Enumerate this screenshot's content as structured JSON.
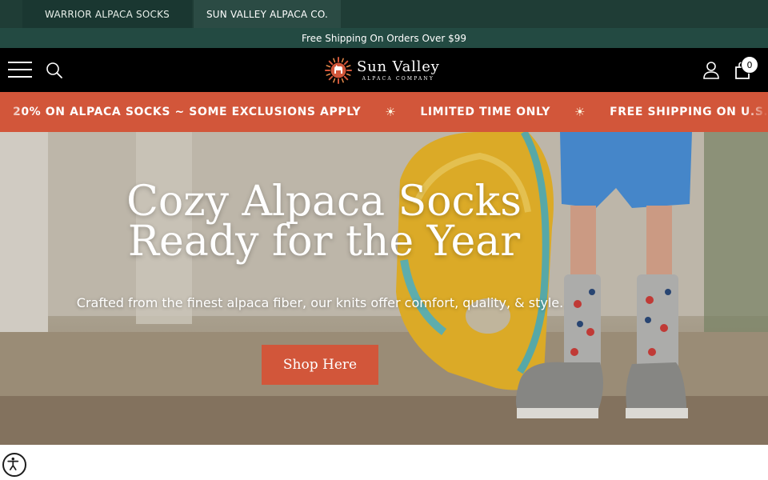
{
  "brand_tabs": [
    {
      "label": "WARRIOR ALPACA SOCKS"
    },
    {
      "label": "SUN VALLEY ALPACA CO."
    }
  ],
  "announcement": "Free Shipping On Orders Over $99",
  "header": {
    "logo_name": "Sun Valley",
    "logo_sub": "ALPACA COMPANY",
    "cart_count": "0",
    "icons": [
      "menu-icon",
      "search-icon",
      "account-icon",
      "cart-icon"
    ]
  },
  "ticker": {
    "items": [
      "20% ON ALPACA SOCKS ~ SOME EXCLUSIONS APPLY",
      "LIMITED TIME ONLY",
      "FREE SHIPPING ON U.S. ORDERS"
    ],
    "separator": "☀"
  },
  "hero": {
    "title_line1": "Cozy Alpaca Socks",
    "title_line2": "Ready for the Year",
    "subtitle": "Crafted from the finest alpaca fiber, our knits offer comfort, quality, & style.",
    "cta": "Shop Here"
  },
  "colors": {
    "brand_bar": "#1f3d36",
    "announce_bar": "#234a42",
    "header": "#000000",
    "accent": "#d2563a"
  }
}
